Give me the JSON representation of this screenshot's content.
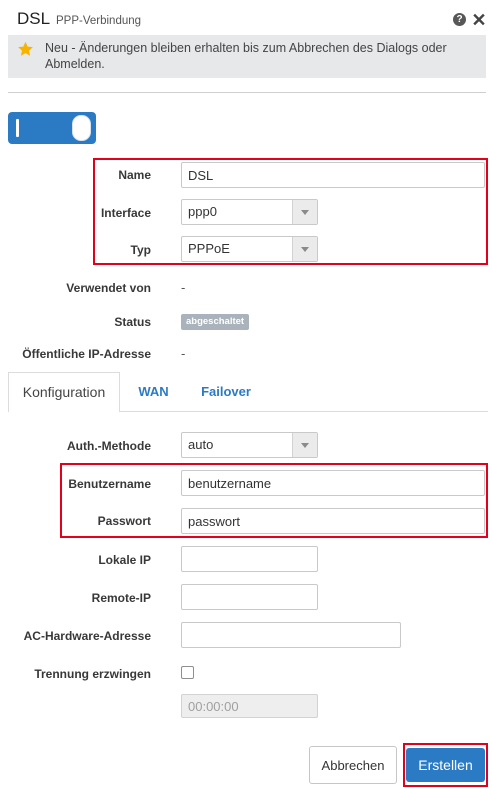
{
  "colors": {
    "accent": "#2b7bc4",
    "highlight": "#e2001a",
    "star": "#f6b400",
    "badge": "#aab3bb",
    "notice_bg": "#e6e8ea"
  },
  "header": {
    "title": "DSL",
    "subtitle": "PPP-Verbindung",
    "help_icon": "help-circle-icon",
    "close_icon": "close-icon"
  },
  "notice": {
    "icon": "star-icon",
    "text": "Neu - Änderungen bleiben erhalten bis zum Abbrechen des Dialogs oder Abmelden."
  },
  "enabled_toggle": {
    "on": true
  },
  "general": {
    "name": {
      "label": "Name",
      "value": "DSL"
    },
    "interface": {
      "label": "Interface",
      "value": "ppp0"
    },
    "typ": {
      "label": "Typ",
      "value": "PPPoE"
    },
    "used_by": {
      "label": "Verwendet von",
      "value": "-"
    },
    "status": {
      "label": "Status",
      "value": "abgeschaltet"
    },
    "public_ip": {
      "label": "Öffentliche IP-Adresse",
      "value": "-"
    }
  },
  "tabs": [
    {
      "label": "Konfiguration",
      "active": true
    },
    {
      "label": "WAN",
      "active": false
    },
    {
      "label": "Failover",
      "active": false
    }
  ],
  "configuration": {
    "auth_method": {
      "label": "Auth.-Methode",
      "value": "auto"
    },
    "username": {
      "label": "Benutzername",
      "value": "benutzername"
    },
    "password": {
      "label": "Passwort",
      "value": "passwort"
    },
    "local_ip": {
      "label": "Lokale IP",
      "value": ""
    },
    "remote_ip": {
      "label": "Remote-IP",
      "value": ""
    },
    "ac_hw_address": {
      "label": "AC-Hardware-Adresse",
      "value": ""
    },
    "force_disconnect": {
      "label": "Trennung erzwingen",
      "checked": false,
      "time": "00:00:00",
      "time_disabled": true
    }
  },
  "footer": {
    "cancel_label": "Abbrechen",
    "create_label": "Erstellen"
  }
}
